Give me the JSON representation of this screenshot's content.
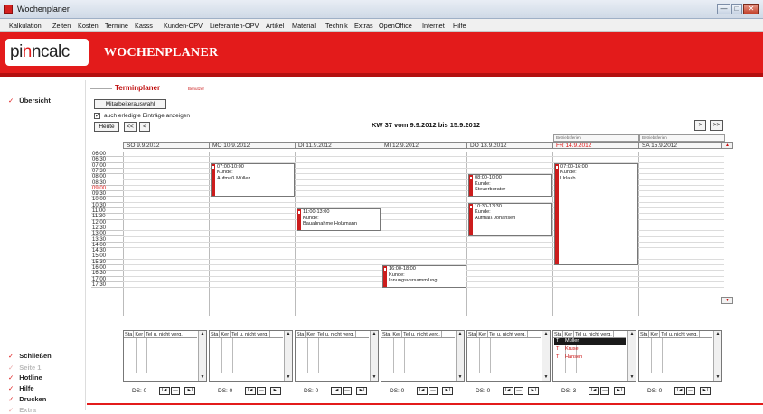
{
  "window": {
    "title": "Wochenplaner",
    "min": "—",
    "max": "□",
    "close": "✕"
  },
  "menu": [
    "Kalkulation",
    "Zeiten",
    "Kosten",
    "Termine",
    "Kasss",
    "Kunden-OPV",
    "Lieferanten-OPV",
    "Artikel",
    "Material",
    "Technik",
    "Extras",
    "OpenOffice",
    "Internet",
    "Hilfe"
  ],
  "brand": {
    "logo_prefix": "pi",
    "logo_accent": "n",
    "logo_suffix": "ncalc",
    "heading": "WOCHENPLANER"
  },
  "sidebar": {
    "top": {
      "label": "Übersicht"
    },
    "bottom": [
      {
        "label": "Schließen",
        "disabled": false
      },
      {
        "label": "Seite 1",
        "disabled": true
      },
      {
        "label": "Hotline",
        "disabled": false
      },
      {
        "label": "Hilfe",
        "disabled": false
      },
      {
        "label": "Drucken",
        "disabled": false
      },
      {
        "label": "Extra",
        "disabled": true
      }
    ]
  },
  "planner": {
    "section_title": "Terminplaner",
    "note": "Benutzer",
    "staff_button": "Mitarbeiterauswahl",
    "show_done_checked": true,
    "show_done_label": "auch erledigte Einträge anzeigen",
    "today_button": "Heute",
    "prev_week_button": "<<",
    "prev_button": "<",
    "next_button": ">",
    "next_week_button": ">>",
    "week_title": "KW 37 vom 9.9.2012 bis 15.9.2012",
    "holiday_labels": [
      "Betriebsferien",
      "Betriebsferien"
    ],
    "days": [
      "SO 9.9.2012",
      "MO 10.9.2012",
      "DI 11.9.2012",
      "MI 12.9.2012",
      "DO 13.9.2012",
      "FR 14.9.2012",
      "SA 15.9.2012"
    ],
    "today_index": 5,
    "times": [
      "06:00",
      "06:30",
      "07:00",
      "07:30",
      "08:00",
      "08:30",
      "09:00",
      "09:30",
      "10:00",
      "10:30",
      "11:00",
      "11:30",
      "12:00",
      "12:30",
      "13:00",
      "13:30",
      "14:00",
      "14:30",
      "15:00",
      "15:30",
      "16:00",
      "16:30",
      "17:00",
      "17:30"
    ],
    "marked_time": "09:00",
    "appointments": [
      {
        "day": 1,
        "start": 7.0,
        "end": 10.0,
        "lines": [
          "07:00-10:00",
          "Kunde:",
          "Aufmaß Müller"
        ]
      },
      {
        "day": 2,
        "start": 11.0,
        "end": 13.0,
        "lines": [
          "11:00-13:00",
          "Kunde:",
          "Bauabnahme Holzmann"
        ]
      },
      {
        "day": 3,
        "start": 16.0,
        "end": 18.0,
        "lines": [
          "16:00-18:00",
          "Kunde:",
          "Innungsversammlung"
        ]
      },
      {
        "day": 4,
        "start": 8.0,
        "end": 10.0,
        "lines": [
          "08:00-10:00",
          "Kunde:",
          "Steuerberater"
        ]
      },
      {
        "day": 4,
        "start": 10.5,
        "end": 13.5,
        "lines": [
          "10:30-13:30",
          "Kunde:",
          "Aufmaß Johansen"
        ]
      },
      {
        "day": 5,
        "start": 7.0,
        "end": 16.0,
        "lines": [
          "07:00-16:00",
          "Kunde:",
          "Urlaub"
        ]
      }
    ],
    "scroll_up": "▲",
    "scroll_down": "▼"
  },
  "lists": {
    "headers": [
      "Sta",
      "Ker",
      "Tel u. nicht verg."
    ],
    "ds_prefix": "DS:",
    "boxes": [
      {
        "ds": "0",
        "rows": []
      },
      {
        "ds": "0",
        "rows": []
      },
      {
        "ds": "0",
        "rows": []
      },
      {
        "ds": "0",
        "rows": []
      },
      {
        "ds": "0",
        "rows": []
      },
      {
        "ds": "3",
        "rows": [
          {
            "st": "T",
            "name": "Müller",
            "selected": true
          },
          {
            "st": "T",
            "name": "Kruse",
            "selected": false
          },
          {
            "st": "T",
            "name": "Hansen",
            "selected": false
          }
        ]
      },
      {
        "ds": "0",
        "rows": []
      }
    ],
    "nav": {
      "first": "I◄",
      "minus": "—",
      "next": "►I"
    }
  },
  "colors": {
    "brand_red": "#e31b1b",
    "appt_bar": "#cc1c1c",
    "selected_row": "#1a1a1a"
  }
}
